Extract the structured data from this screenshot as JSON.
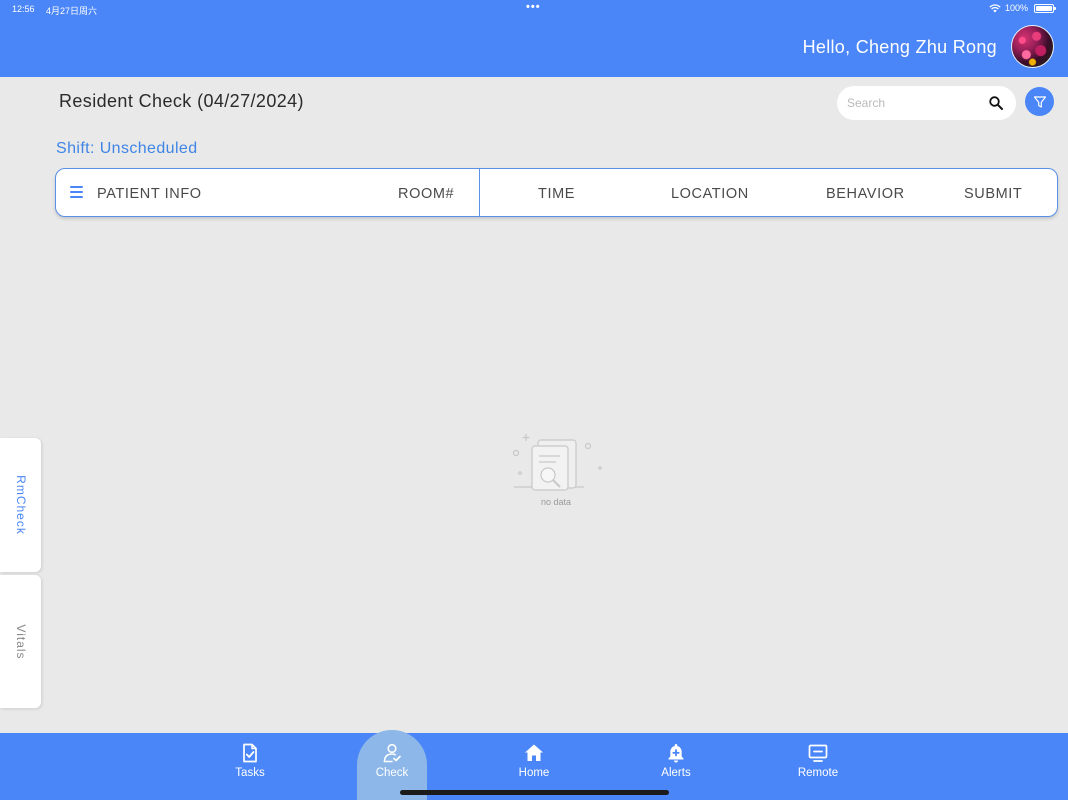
{
  "status_bar": {
    "time": "12:56",
    "date": "4月27日周六",
    "battery": "100%",
    "dots": "•••"
  },
  "header": {
    "greeting": "Hello, Cheng Zhu Rong",
    "background": "#4a86f7"
  },
  "page": {
    "title": "Resident Check (04/27/2024)",
    "shift": "Shift: Unscheduled"
  },
  "search": {
    "placeholder": "Search",
    "value": ""
  },
  "table": {
    "columns": {
      "patient_info": "PATIENT INFO",
      "room": "ROOM#",
      "time": "TIME",
      "location": "LOCATION",
      "behavior": "BEHAVIOR",
      "submit": "SUBMIT"
    },
    "rows": []
  },
  "empty_state": {
    "text": "no data"
  },
  "side_tabs": {
    "rmcheck": "RmCheck",
    "vitals": "Vitals"
  },
  "bottom_nav": {
    "tasks": "Tasks",
    "check": "Check",
    "home": "Home",
    "alerts": "Alerts",
    "remote": "Remote",
    "active": "Check"
  },
  "colors": {
    "accent": "#4a86f7",
    "active_tab": "#8cb7e8",
    "shift_text": "#3f85e6"
  }
}
